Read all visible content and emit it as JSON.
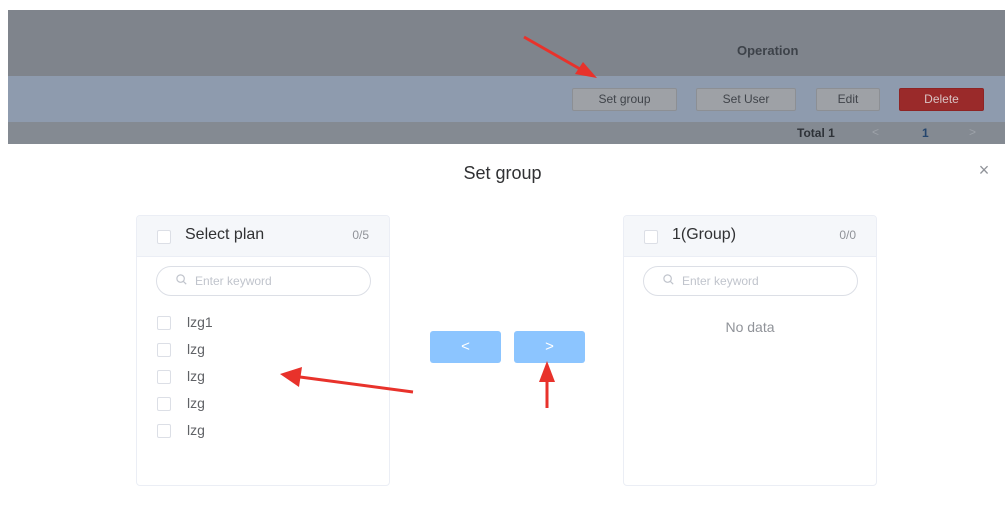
{
  "background": {
    "header": {
      "operation_title": "Operation"
    },
    "row_actions": {
      "set_group": "Set group",
      "set_user": "Set User",
      "edit": "Edit",
      "delete": "Delete"
    },
    "pager": {
      "total": "Total 1",
      "prev": "<",
      "page": "1",
      "next": ">"
    }
  },
  "dialog": {
    "title": "Set group",
    "close": "×",
    "left_panel": {
      "title": "Select plan",
      "count": "0/5",
      "search_placeholder": "Enter keyword",
      "items": [
        "lzg1",
        "lzg",
        "lzg",
        "lzg",
        "lzg"
      ]
    },
    "right_panel": {
      "title": "1(Group)",
      "count": "0/0",
      "search_placeholder": "Enter keyword",
      "empty_text": "No data"
    },
    "transfer": {
      "to_left": "<",
      "to_right": ">"
    }
  },
  "colors": {
    "accent": "#8cc5ff",
    "delete": "#9a2a2a",
    "annotation": "#e8322b"
  },
  "icons": {
    "search": "search-icon",
    "close": "close-icon"
  }
}
